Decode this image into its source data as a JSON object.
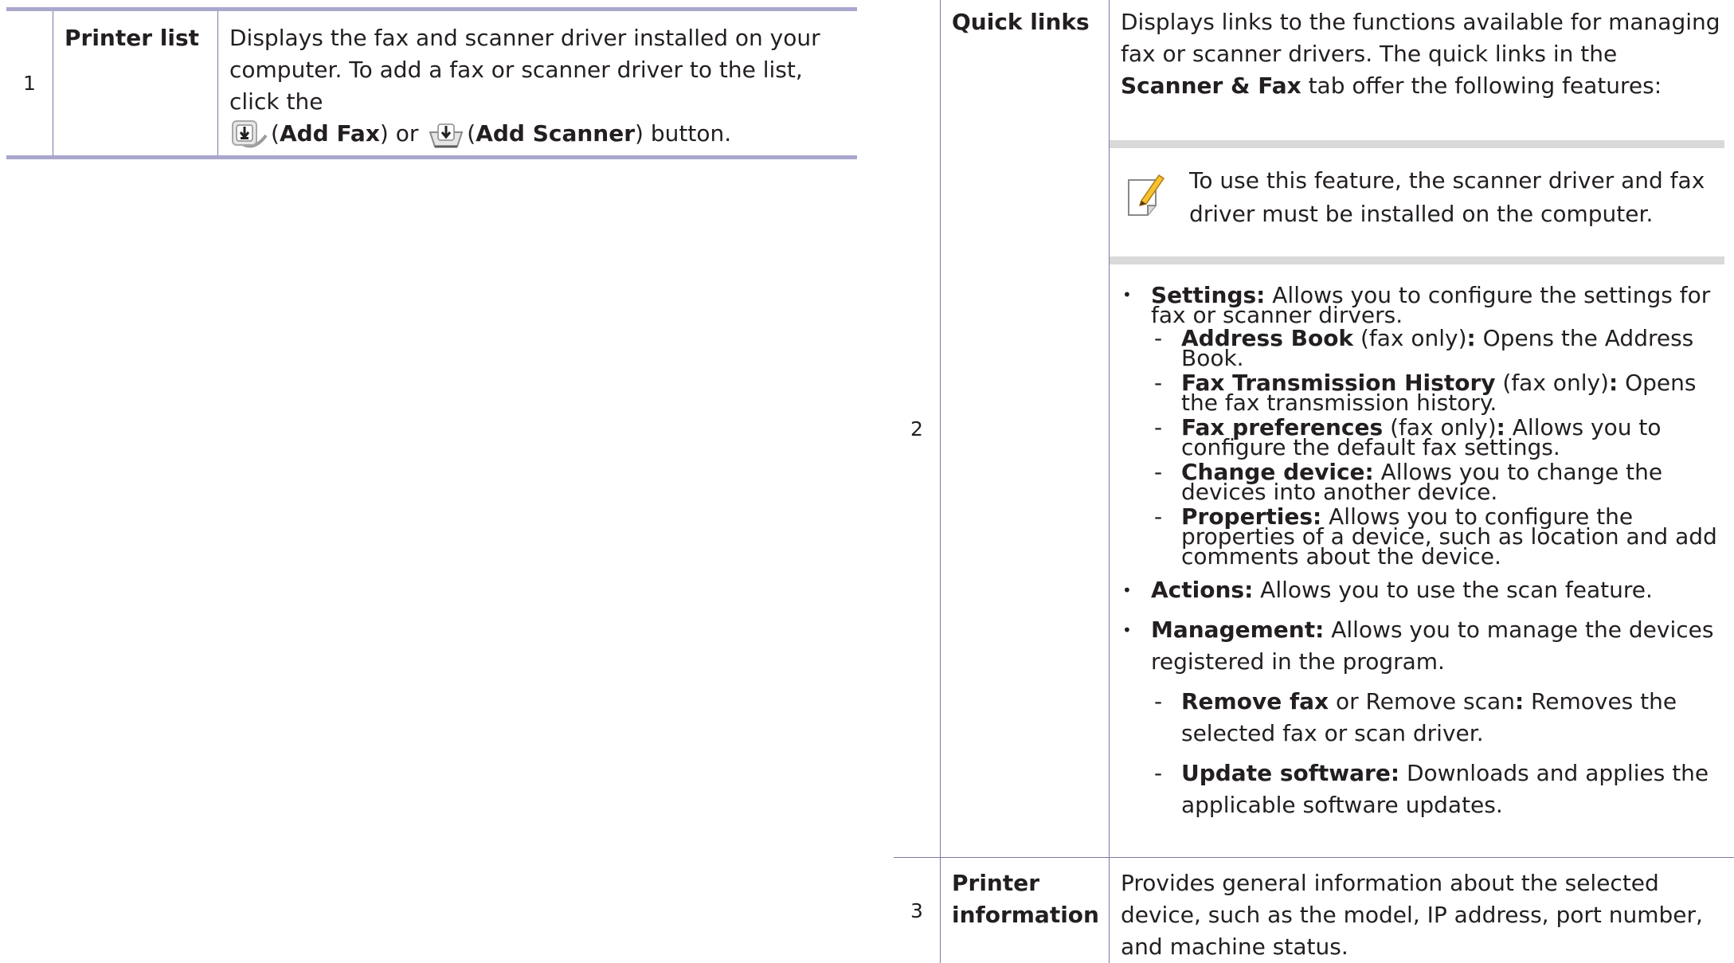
{
  "left_table": {
    "rows": [
      {
        "number": "1",
        "label": "Printer list",
        "desc_intro": "Displays the fax and scanner driver installed on your computer. To add a fax or scanner driver to the list, click the",
        "add_fax_open": "(",
        "add_fax_label": "Add Fax",
        "add_fax_close": ") or",
        "add_scanner_open": "(",
        "add_scanner_label": "Add Scanner",
        "desc_end": ") button."
      }
    ]
  },
  "right_table": {
    "row2": {
      "number": "2",
      "label": "Quick links",
      "intro_a": "Displays links to the functions available for managing fax or scanner drivers. The quick links in the ",
      "intro_bold": "Scanner & Fax",
      "intro_b": " tab offer the following features:",
      "note_icon": "note-pencil-icon",
      "note_text": "To use this feature, the scanner driver and fax driver must be installed on the computer.",
      "bullets": [
        {
          "bold": "Settings:",
          "text": " Allows you to configure the settings for fax or scanner dirvers.",
          "subs": [
            {
              "bold": "Address Book",
              "mid": " (fax only)",
              "colon": ":",
              "text": " Opens the Address Book."
            },
            {
              "bold": "Fax Transmission History",
              "mid": " (fax only)",
              "colon": ":",
              "text": " Opens the fax transmission history."
            },
            {
              "bold": "Fax preferences",
              "mid": " (fax only)",
              "colon": ":",
              "text": " Allows you to configure the default fax settings."
            },
            {
              "bold": "Change device:",
              "mid": "",
              "colon": "",
              "text": " Allows you to change the devices into another device."
            },
            {
              "bold": "Properties:",
              "mid": "",
              "colon": "",
              "text": " Allows you to configure the properties of a device, such as location and add comments about the device."
            }
          ]
        },
        {
          "bold": "Actions:",
          "text": " Allows you to use the scan feature."
        },
        {
          "bold": "Management:",
          "text": " Allows you to manage the devices registered in the program.",
          "subs": [
            {
              "bold": "Remove fax",
              "mid": " or Remove scan",
              "colon": ":",
              "text": " Removes the selected fax or scan driver."
            },
            {
              "bold": "Update software:",
              "mid": "",
              "colon": "",
              "text": " Downloads and applies the applicable software updates."
            }
          ]
        }
      ]
    },
    "row3": {
      "number": "3",
      "label_line1": "Printer",
      "label_line2": "information",
      "desc": "Provides general information about the selected device, such as the model, IP address, port number, and machine status."
    }
  }
}
